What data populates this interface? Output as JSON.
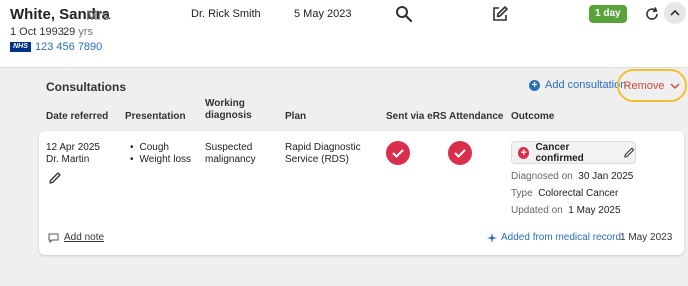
{
  "patient": {
    "name": "White, Sandra",
    "title": "Mrs",
    "dob": "1 Oct 1993",
    "age": "29",
    "age_unit": "yrs",
    "nhs_label": "NHS",
    "nhs_number": "123 456 7890"
  },
  "header": {
    "doctor": "Dr. Rick Smith",
    "date": "5 May 2023",
    "day_badge": "1 day",
    "icons": [
      "search-icon",
      "edit-icon",
      "refresh-icon",
      "chevron-up-icon"
    ]
  },
  "consultations": {
    "title": "Consultations",
    "add_label": "Add consultation",
    "remove_label": "Remove",
    "columns": {
      "date_referred": "Date referred",
      "presentation": "Presentation",
      "working_diagnosis_1": "Working",
      "working_diagnosis_2": "diagnosis",
      "plan": "Plan",
      "sent_via_ers": "Sent via eRS",
      "attendance": "Attendance",
      "outcome": "Outcome"
    },
    "row": {
      "date": "12 Apr 2025",
      "doctor": "Dr. Martin",
      "presentation": [
        "Cough",
        "Weight loss"
      ],
      "working_diagnosis_1": "Suspected",
      "working_diagnosis_2": "malignancy",
      "plan_1": "Rapid Diagnostic",
      "plan_2": "Service (RDS)",
      "sent_via_ers": true,
      "attendance": true,
      "outcome": "Cancer confirmed",
      "diagnosed_label": "Diagnosed on",
      "diagnosed_date": "30 Jan 2025",
      "type_label": "Type",
      "type_value": "Colorectal Cancer",
      "updated_label": "Updated on",
      "updated_date": "1 May 2025"
    },
    "footer": {
      "add_note": "Add note",
      "added_from": "Added from medical record",
      "added_date": "1 May 2023"
    }
  },
  "colors": {
    "accent_blue": "#2a6ebb",
    "check_red": "#d92f4c",
    "remove_red": "#d4463c",
    "badge_green": "#5aa33a",
    "highlight_yellow": "#f0c030"
  }
}
